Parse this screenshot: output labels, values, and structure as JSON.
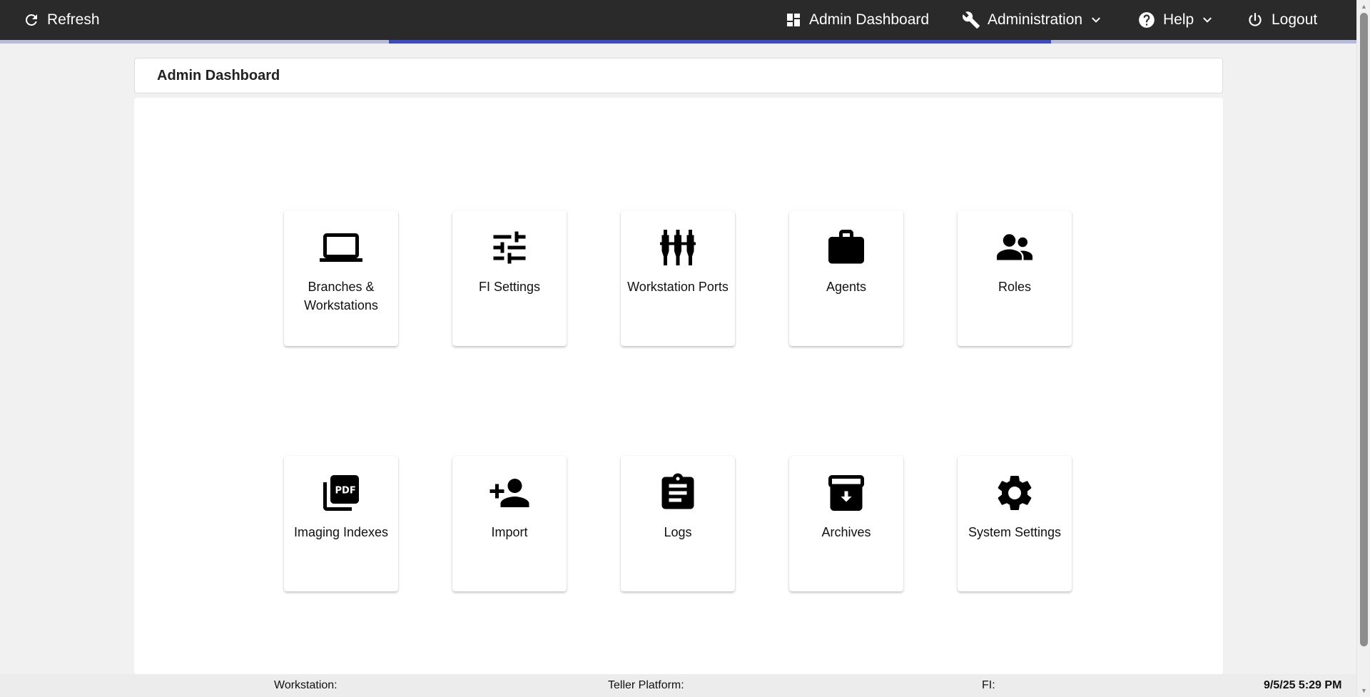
{
  "topbar": {
    "refresh_label": "Refresh",
    "admin_dashboard_label": "Admin Dashboard",
    "administration_label": "Administration",
    "help_label": "Help",
    "logout_label": "Logout"
  },
  "page": {
    "title": "Admin Dashboard"
  },
  "tiles": [
    {
      "label": "Branches & Workstations",
      "icon": "laptop-icon"
    },
    {
      "label": "FI Settings",
      "icon": "tune-icon"
    },
    {
      "label": "Workstation Ports",
      "icon": "ports-icon"
    },
    {
      "label": "Agents",
      "icon": "briefcase-icon"
    },
    {
      "label": "Roles",
      "icon": "people-icon"
    },
    {
      "label": "Imaging Indexes",
      "icon": "pdf-icon"
    },
    {
      "label": "Import",
      "icon": "person-add-icon"
    },
    {
      "label": "Logs",
      "icon": "clipboard-icon"
    },
    {
      "label": "Archives",
      "icon": "archive-icon"
    },
    {
      "label": "System Settings",
      "icon": "gear-icon"
    }
  ],
  "statusbar": {
    "workstation_label": "Workstation:",
    "teller_platform_label": "Teller Platform:",
    "fi_label": "FI:",
    "datetime": "9/5/25 5:29 PM"
  },
  "colors": {
    "topbar_bg": "#2a2a2a",
    "accent": "#3f4cb4",
    "page_bg": "#f1f1f1"
  }
}
